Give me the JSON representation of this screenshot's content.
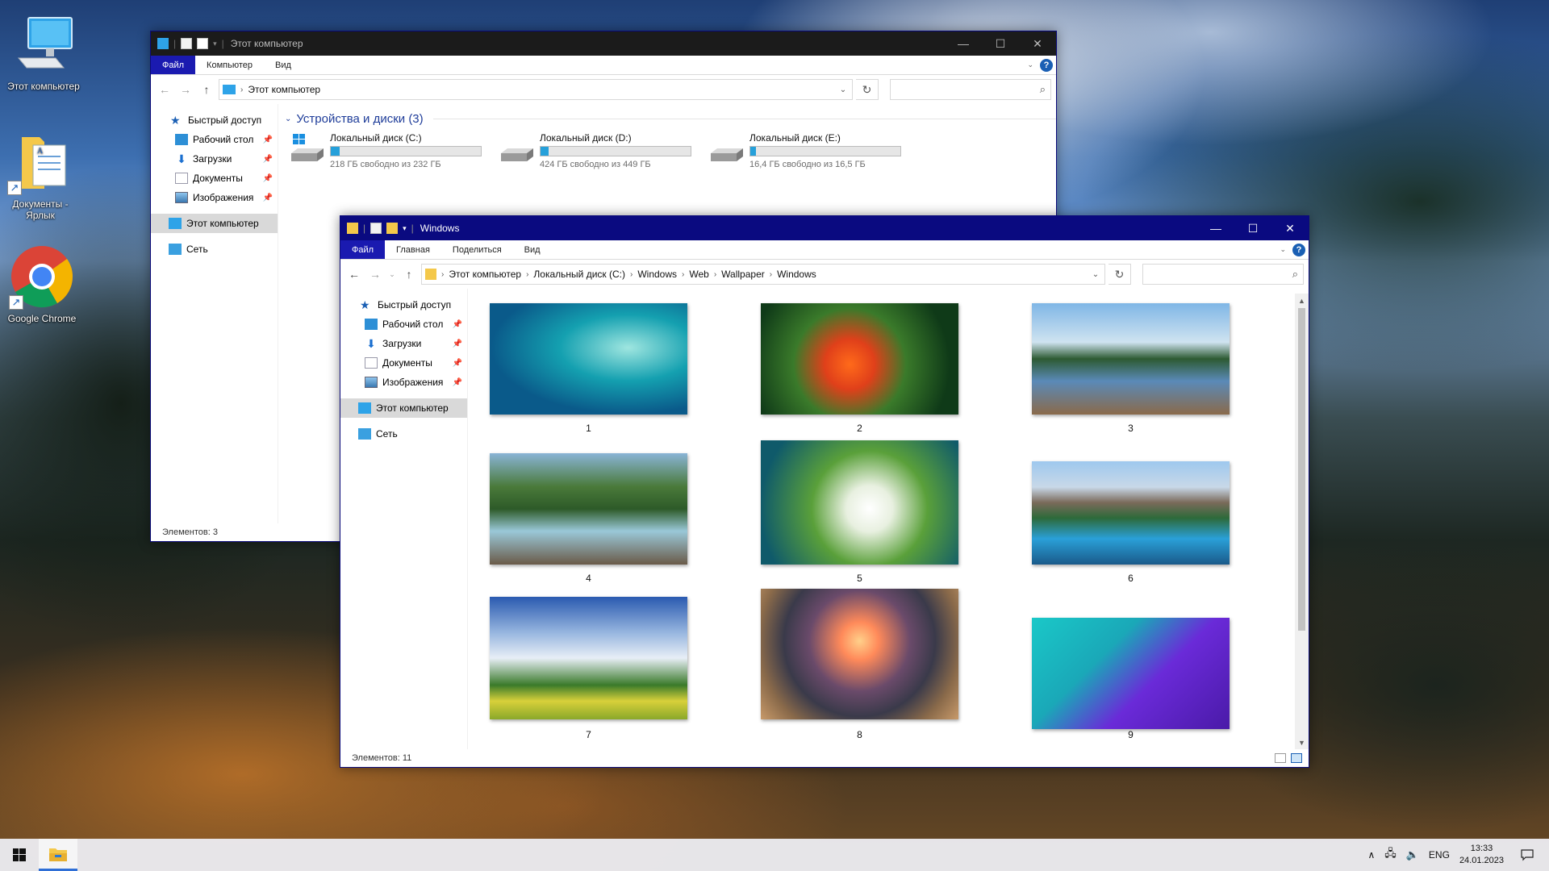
{
  "desktop": {
    "icons": [
      {
        "label": "Этот компьютер",
        "icon": "computer-icon"
      },
      {
        "label": "Документы - Ярлык",
        "icon": "documents-shortcut-icon"
      },
      {
        "label": "Google Chrome",
        "icon": "chrome-icon"
      }
    ]
  },
  "window_pc": {
    "title": "Этот компьютер",
    "tabs": [
      "Файл",
      "Компьютер",
      "Вид"
    ],
    "address": [
      "Этот компьютер"
    ],
    "section_title": "Устройства и диски (3)",
    "drives": [
      {
        "name": "Локальный диск (C:)",
        "free": "218 ГБ свободно из 232 ГБ",
        "used_fraction": 0.06
      },
      {
        "name": "Локальный диск (D:)",
        "free": "424 ГБ свободно из 449 ГБ",
        "used_fraction": 0.056
      },
      {
        "name": "Локальный диск (E:)",
        "free": "16,4 ГБ свободно из 16,5 ГБ",
        "used_fraction": 0.006
      }
    ],
    "status": "Элементов: 3"
  },
  "window_wall": {
    "title": "Windows",
    "tabs": [
      "Файл",
      "Главная",
      "Поделиться",
      "Вид"
    ],
    "address": [
      "Этот компьютер",
      "Локальный диск (C:)",
      "Windows",
      "Web",
      "Wallpaper",
      "Windows"
    ],
    "thumbs": [
      "1",
      "2",
      "3",
      "4",
      "5",
      "6",
      "7",
      "8",
      "9"
    ],
    "status": "Элементов: 11"
  },
  "sidebar": {
    "quick_access": "Быстрый доступ",
    "items": [
      "Рабочий стол",
      "Загрузки",
      "Документы",
      "Изображения"
    ],
    "this_pc": "Этот компьютер",
    "network": "Сеть"
  },
  "taskbar": {
    "lang": "ENG",
    "time": "13:33",
    "date": "24.01.2023"
  },
  "colors": {
    "accent": "#1a1ab0",
    "titlebar_active": "#0a0a80",
    "titlebar_inactive": "#1b1b1b",
    "drive_bar": "#26a0da"
  }
}
